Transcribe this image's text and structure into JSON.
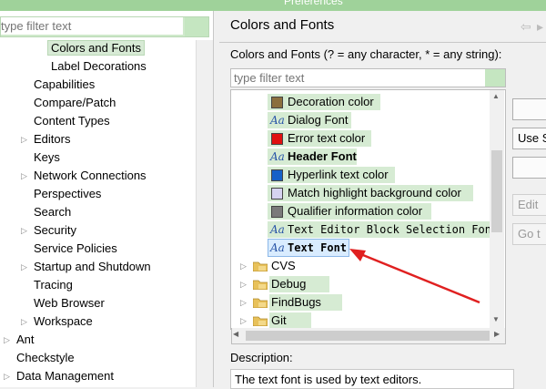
{
  "window": {
    "title": "Preferences"
  },
  "left": {
    "filter_placeholder": "type filter text",
    "items": [
      {
        "label": "Colors and Fonts",
        "selected": true
      },
      {
        "label": "Label Decorations"
      },
      {
        "label": "Capabilities"
      },
      {
        "label": "Compare/Patch"
      },
      {
        "label": "Content Types"
      },
      {
        "label": "Editors"
      },
      {
        "label": "Keys"
      },
      {
        "label": "Network Connections"
      },
      {
        "label": "Perspectives"
      },
      {
        "label": "Search"
      },
      {
        "label": "Security"
      },
      {
        "label": "Service Policies"
      },
      {
        "label": "Startup and Shutdown"
      },
      {
        "label": "Tracing"
      },
      {
        "label": "Web Browser"
      },
      {
        "label": "Workspace"
      },
      {
        "label": "Ant"
      },
      {
        "label": "Checkstyle"
      },
      {
        "label": "Data Management"
      }
    ]
  },
  "right": {
    "title": "Colors and Fonts",
    "filter_label": "Colors and Fonts (? = any character, * = any string):",
    "filter_placeholder": "type filter text",
    "entries": [
      {
        "label": "Decoration color",
        "kind": "color",
        "color": "#8b6f3e"
      },
      {
        "label": "Dialog Font",
        "kind": "font"
      },
      {
        "label": "Error text color",
        "kind": "color",
        "color": "#e01010"
      },
      {
        "label": "Header Font",
        "kind": "font"
      },
      {
        "label": "Hyperlink text color",
        "kind": "color",
        "color": "#1560c8"
      },
      {
        "label": "Match highlight background color",
        "kind": "color",
        "color": "#d6d3f0"
      },
      {
        "label": "Qualifier information color",
        "kind": "color",
        "color": "#7a7a7a"
      },
      {
        "label": "Text Editor Block Selection Font",
        "kind": "font"
      },
      {
        "label": "Text Font",
        "kind": "font",
        "selected": true
      }
    ],
    "font_icon_text": "Aa",
    "folders": [
      {
        "label": "CVS"
      },
      {
        "label": "Debug"
      },
      {
        "label": "FindBugs"
      },
      {
        "label": "Git"
      }
    ],
    "buttons": {
      "use_system": "Use S",
      "edit": "Edit",
      "goto": "Go t"
    },
    "description_label": "Description:",
    "description_text": "The text font is used by text editors."
  },
  "colors": {
    "highlight": "#d6ebd3",
    "annotation_arrow": "#e02020"
  }
}
